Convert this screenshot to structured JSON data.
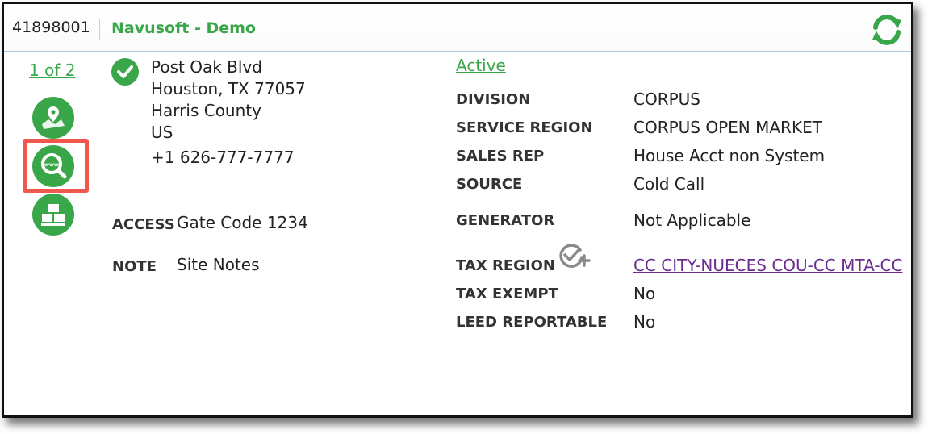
{
  "header": {
    "site_id": "41898001",
    "site_name": "Navusoft - Demo",
    "refresh_icon": "refresh-icon"
  },
  "pager": "1 of 2",
  "side_icons": [
    "map-location-icon",
    "web-search-icon",
    "containers-icon"
  ],
  "address": {
    "line1": "Post Oak Blvd",
    "line2": "Houston, TX 77057",
    "line3": "Harris County",
    "line4": "US",
    "phone": "+1 626-777-7777"
  },
  "access": {
    "label": "ACCESS",
    "value": "Gate Code 1234"
  },
  "note": {
    "label": "NOTE",
    "value": "Site Notes"
  },
  "status": "Active",
  "details": {
    "division": {
      "label": "DIVISION",
      "value": "CORPUS"
    },
    "service_region": {
      "label": "SERVICE REGION",
      "value": "CORPUS OPEN MARKET"
    },
    "sales_rep": {
      "label": "SALES REP",
      "value": "House Acct non System"
    },
    "source": {
      "label": "SOURCE",
      "value": "Cold Call"
    },
    "generator": {
      "label": "GENERATOR",
      "value": "Not Applicable"
    },
    "tax_region": {
      "label": "TAX REGION",
      "value": "CC CITY-NUECES COU-CC MTA-CC"
    },
    "tax_exempt": {
      "label": "TAX EXEMPT",
      "value": "No"
    },
    "leed": {
      "label": "LEED REPORTABLE",
      "value": "No"
    }
  },
  "colors": {
    "accent_green": "#3aa64a",
    "link_purple": "#6b2c8f",
    "highlight_red": "#f0584e",
    "header_border": "#a9c8e8"
  }
}
